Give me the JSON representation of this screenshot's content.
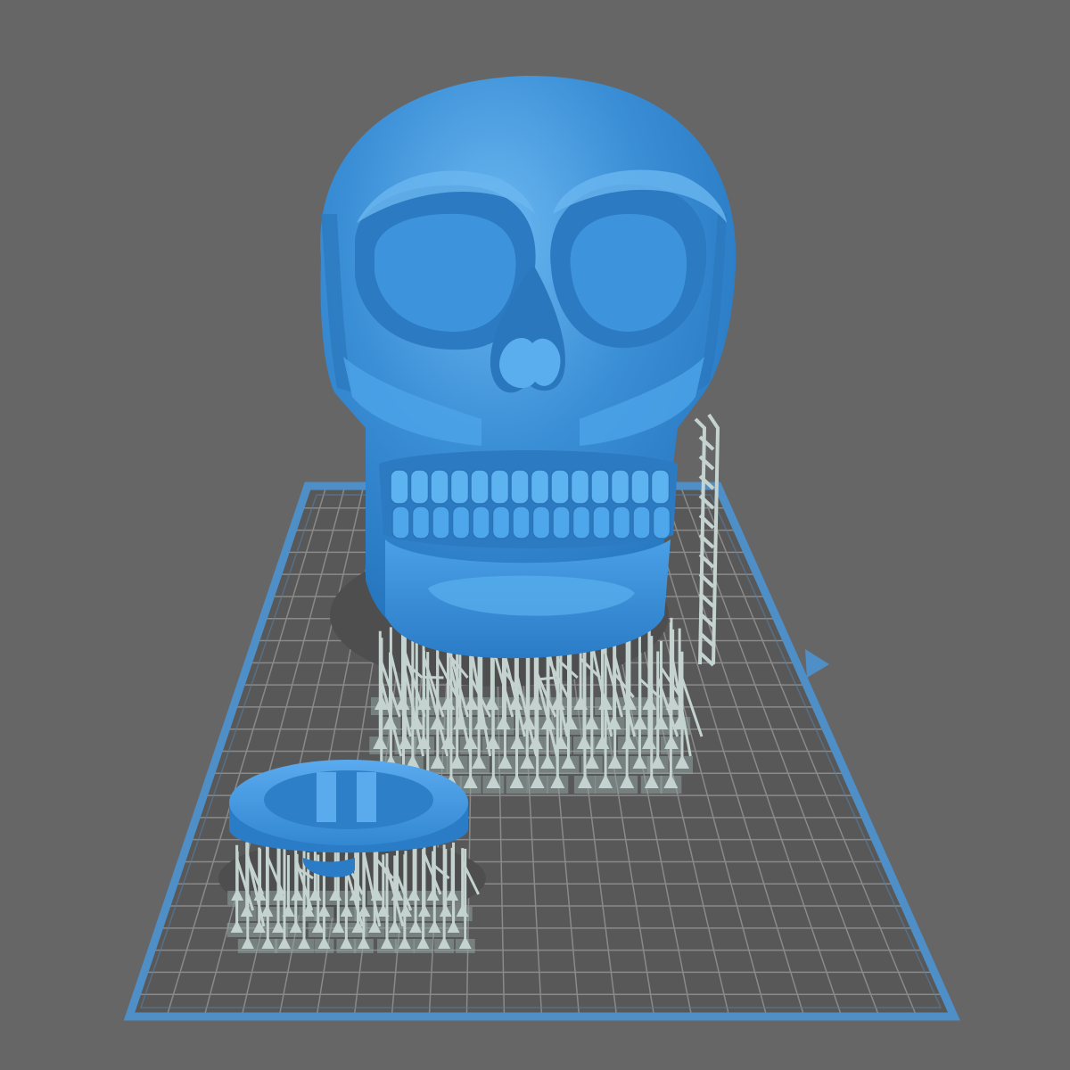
{
  "viewport": {
    "background": "#666666",
    "plate_color": "#4f8fc7",
    "grid_color": "#8a8a8a",
    "plate_fill": "#585858",
    "model_color": "#3b8fd6",
    "support_color": "#c4d3cf",
    "support_pad_color": "#8fa39e"
  },
  "scene": {
    "models": [
      "skull",
      "lid"
    ],
    "orientation_marker": "triangle-arrow-icon"
  }
}
